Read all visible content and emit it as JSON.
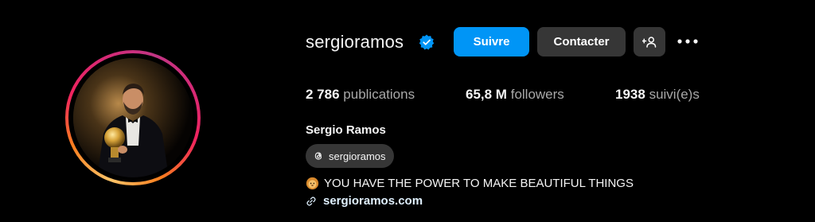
{
  "profile": {
    "username": "sergioramos",
    "full_name": "Sergio Ramos",
    "verified": true,
    "stats": {
      "posts_count": "2 786",
      "posts_label": "publications",
      "followers_count": "65,8 M",
      "followers_label": "followers",
      "following_count": "1938",
      "following_label": "suivi(e)s"
    },
    "threads_handle": "sergioramos",
    "bio": "YOU HAVE THE POWER TO MAKE BEAUTIFUL THINGS",
    "bio_icon": "lion-face-icon",
    "link": "sergioramos.com"
  },
  "actions": {
    "follow_label": "Suivre",
    "contact_label": "Contacter",
    "suggest_icon": "add-person-icon",
    "more_icon": "more-options-icon"
  },
  "colors": {
    "background": "#000000",
    "primary_button": "#0095f6",
    "secondary_button": "#363636",
    "verified_badge": "#0095f6",
    "muted_text": "#a8a8a8",
    "link_text": "#e0f1ff"
  }
}
